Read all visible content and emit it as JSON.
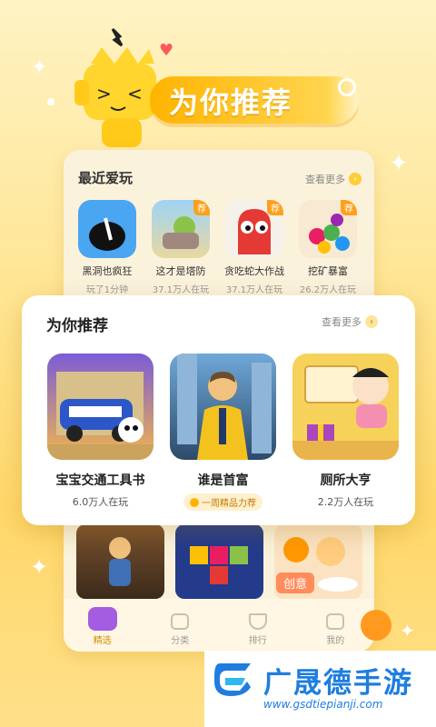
{
  "hero": {
    "title": "为你推荐"
  },
  "recent": {
    "header": "最近爱玩",
    "see_more": "查看更多",
    "items": [
      {
        "name": "黑洞也疯狂",
        "stat": "玩了1分钟",
        "tag": ""
      },
      {
        "name": "这才是塔防",
        "stat": "37.1万人在玩",
        "tag": "荐"
      },
      {
        "name": "贪吃蛇大作战",
        "stat": "37.1万人在玩",
        "tag": "荐"
      },
      {
        "name": "挖矿暴富",
        "stat": "26.2万人在玩",
        "tag": "荐"
      }
    ]
  },
  "recommend": {
    "title": "为你推荐",
    "see_more": "查看更多",
    "items": [
      {
        "name": "宝宝交通工具书",
        "stat": "6.0万人在玩",
        "badge": ""
      },
      {
        "name": "谁是首富",
        "stat": "",
        "badge": "一周精品力荐"
      },
      {
        "name": "厕所大亨",
        "stat": "2.2万人在玩",
        "badge": ""
      }
    ]
  },
  "lower": {
    "create_tag": "创意"
  },
  "tabs": [
    {
      "label": "精选",
      "active": true
    },
    {
      "label": "分类",
      "active": false
    },
    {
      "label": "排行",
      "active": false
    },
    {
      "label": "我的",
      "active": false
    }
  ],
  "watermark": {
    "title": "广晟德手游",
    "url": "www.gsdtiepianji.com"
  },
  "colors": {
    "accent": "#ffb400",
    "brand_blue": "#1f7de0",
    "tab_active": "#d48a00"
  }
}
